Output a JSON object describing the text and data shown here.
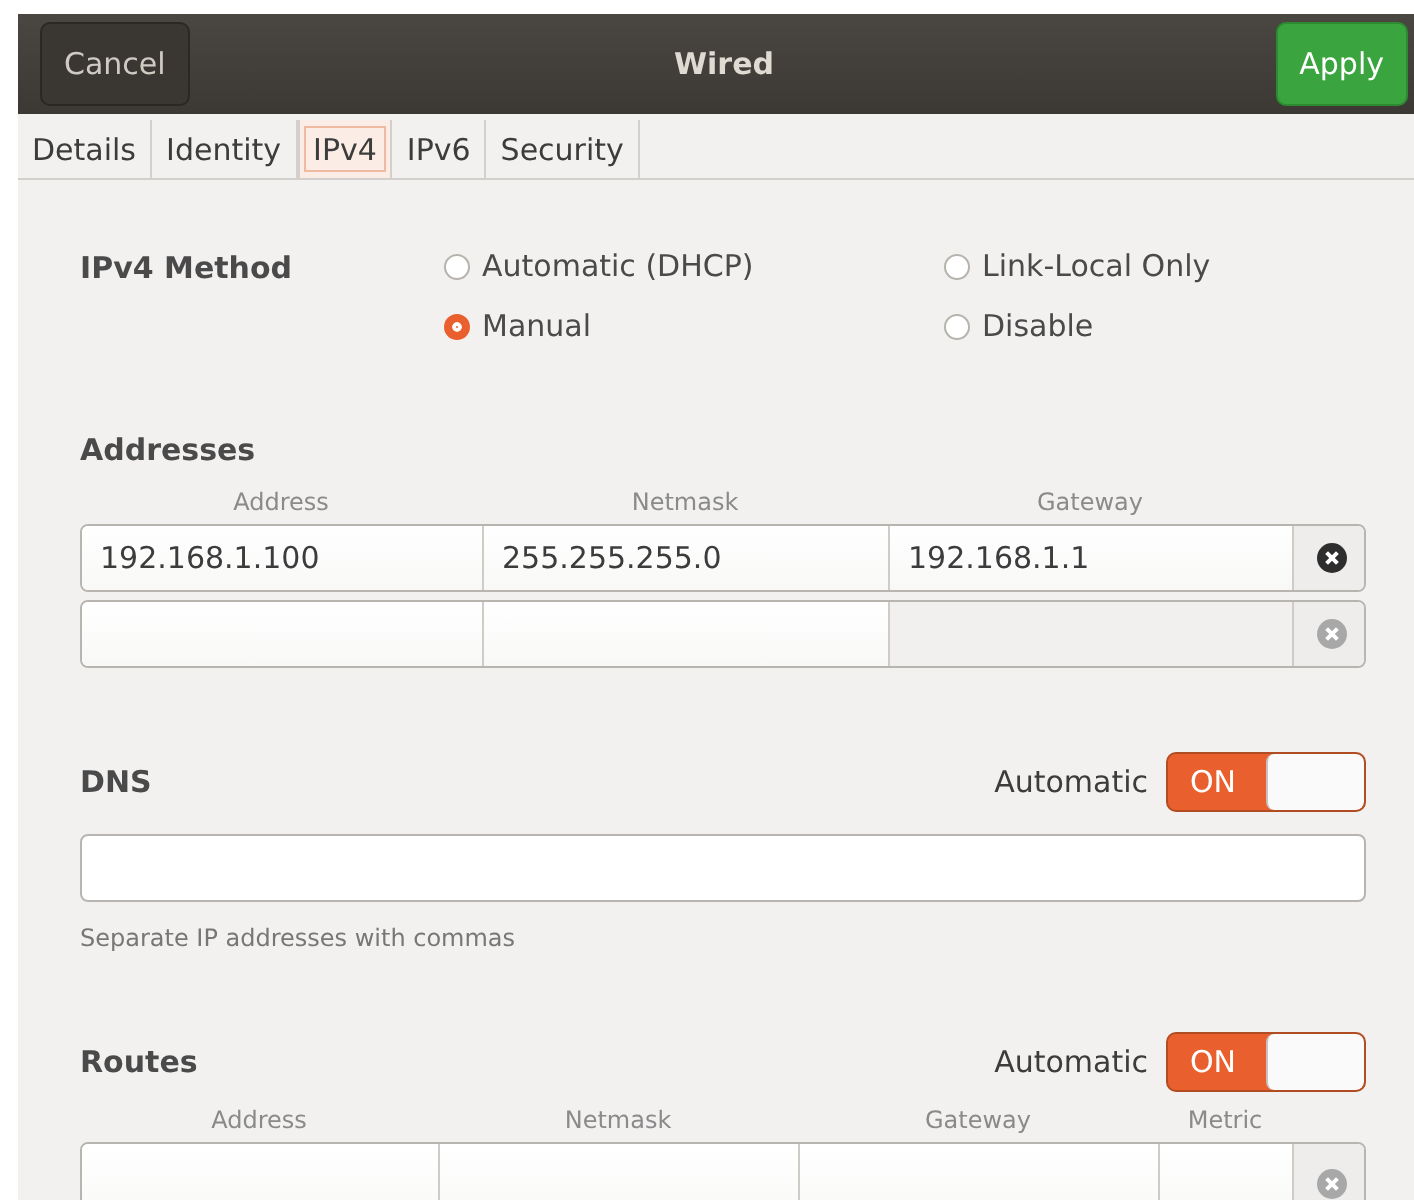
{
  "window": {
    "title": "Wired",
    "cancel": "Cancel",
    "apply": "Apply"
  },
  "tabs": [
    {
      "label": "Details",
      "selected": false
    },
    {
      "label": "Identity",
      "selected": false
    },
    {
      "label": "IPv4",
      "selected": true
    },
    {
      "label": "IPv6",
      "selected": false
    },
    {
      "label": "Security",
      "selected": false
    }
  ],
  "method": {
    "label": "IPv4 Method",
    "options": [
      {
        "label": "Automatic (DHCP)",
        "selected": false
      },
      {
        "label": "Link-Local Only",
        "selected": false
      },
      {
        "label": "Manual",
        "selected": true
      },
      {
        "label": "Disable",
        "selected": false
      }
    ]
  },
  "addresses": {
    "title": "Addresses",
    "columns": [
      "Address",
      "Netmask",
      "Gateway"
    ],
    "rows": [
      {
        "cells": [
          "192.168.1.100",
          "255.255.255.0",
          "192.168.1.1"
        ],
        "disabled": false
      },
      {
        "cells": [],
        "disabled": true
      }
    ]
  },
  "dns": {
    "title": "DNS",
    "automatic_label": "Automatic",
    "toggle_on": true,
    "toggle_text": "ON",
    "hint": "Separate IP addresses with commas"
  },
  "routes": {
    "title": "Routes",
    "automatic_label": "Automatic",
    "toggle_on": true,
    "toggle_text": "ON",
    "columns": [
      "Address",
      "Netmask",
      "Gateway",
      "Metric"
    ]
  }
}
